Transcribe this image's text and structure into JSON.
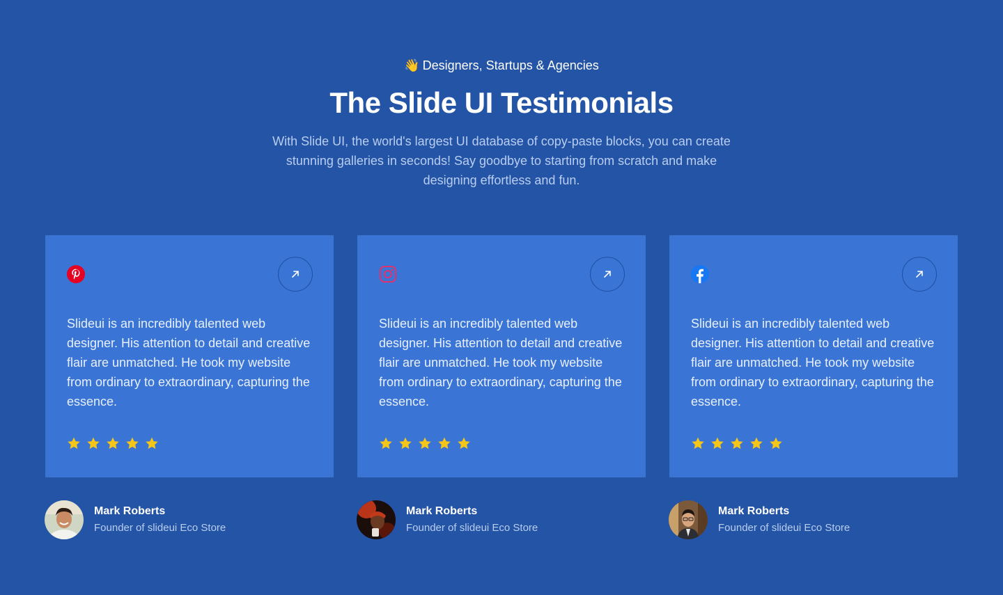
{
  "header": {
    "eyebrow_emoji": "👋",
    "eyebrow": "Designers, Startups & Agencies",
    "title": "The Slide UI Testimonials",
    "subtitle": "With Slide UI, the world's largest UI database of copy-paste blocks, you can create stunning galleries in seconds! Say goodbye to starting from scratch and make designing effortless and fun."
  },
  "testimonials": [
    {
      "brand_icon": "pinterest-icon",
      "quote": "Slideui is an incredibly talented web designer. His attention to detail and creative flair are unmatched. He took my website from ordinary to extraordinary, capturing the essence.",
      "rating": 5,
      "author": {
        "name": "Mark Roberts",
        "role": "Founder of slideui Eco Store"
      }
    },
    {
      "brand_icon": "instagram-icon",
      "quote": "Slideui is an incredibly talented web designer. His attention to detail and creative flair are unmatched. He took my website from ordinary to extraordinary, capturing the essence.",
      "rating": 5,
      "author": {
        "name": "Mark Roberts",
        "role": "Founder of slideui Eco Store"
      }
    },
    {
      "brand_icon": "facebook-icon",
      "quote": "Slideui is an incredibly talented web designer. His attention to detail and creative flair are unmatched. He took my website from ordinary to extraordinary, capturing the essence.",
      "rating": 5,
      "author": {
        "name": "Mark Roberts",
        "role": "Founder of slideui Eco Store"
      }
    }
  ],
  "colors": {
    "background": "#2354a6",
    "card": "#3a75d6",
    "star": "#f5c518",
    "pinterest": "#e60023",
    "instagram": "#e1306c",
    "facebook": "#1877f2"
  }
}
